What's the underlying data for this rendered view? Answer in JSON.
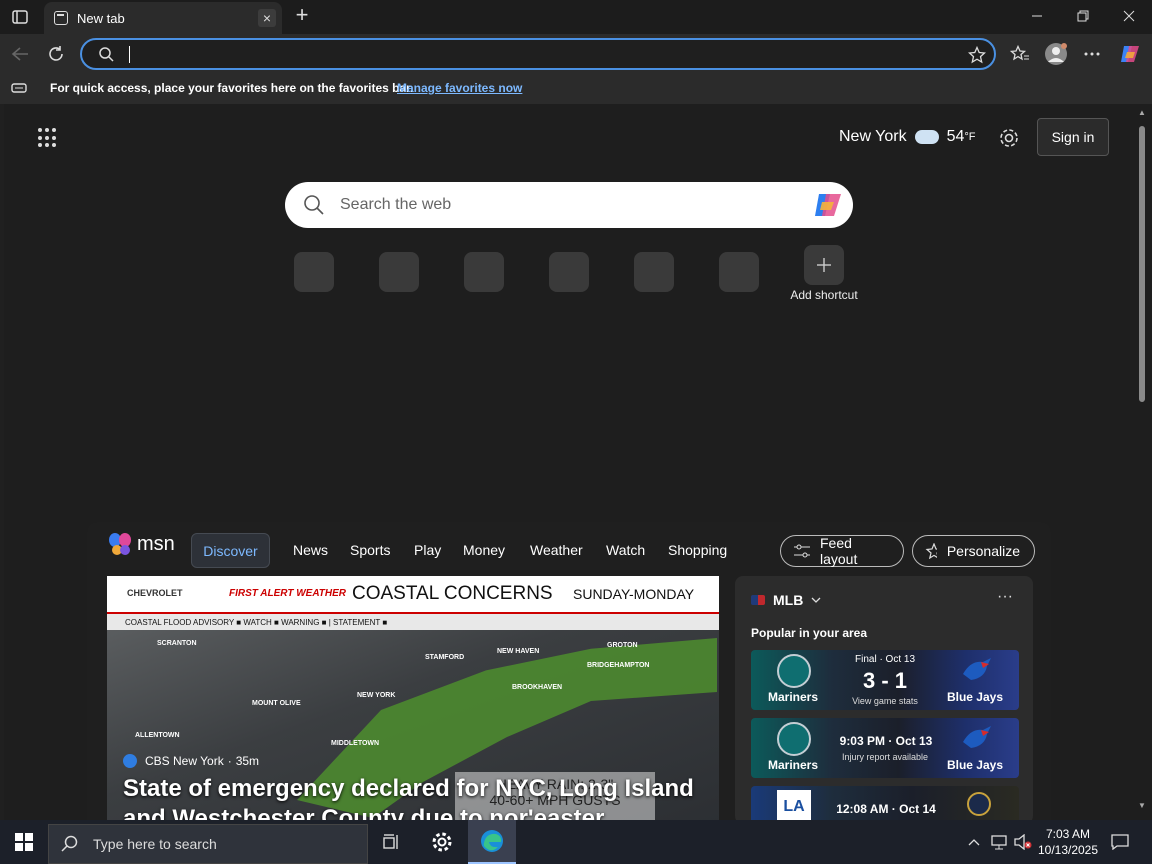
{
  "browser": {
    "tab_title": "New tab",
    "tab_close": "×",
    "new_tab": "+",
    "address_value": "",
    "favbar_message": "For quick access, place your favorites here on the favorites bar.",
    "favbar_link": "Manage favorites now"
  },
  "newtab": {
    "weather_city": "New York",
    "weather_temp": "54",
    "weather_unit": "°F",
    "sign_in": "Sign in",
    "search_placeholder": "Search the web",
    "add_shortcut_label": "Add shortcut"
  },
  "feed": {
    "logo_text": "msn",
    "active_tab": "Discover",
    "nav": [
      "News",
      "Sports",
      "Play",
      "Money",
      "Weather",
      "Watch",
      "Shopping"
    ],
    "feed_layout": "Feed layout",
    "personalize": "Personalize",
    "hero": {
      "banner_brand": "CHEVROLET",
      "banner_alert": "FIRST ALERT WEATHER",
      "banner_headline": "COASTAL CONCERNS",
      "banner_days": "SUNDAY-MONDAY",
      "legend": "COASTAL FLOOD ADVISORY ■  WATCH ■  WARNING ■   |   STATEMENT ■",
      "towns": [
        "SCRANTON",
        "STAMFORD",
        "NEW HAVEN",
        "GROTON",
        "BRIDGEHAMPTON",
        "BROOKHAVEN",
        "NEW YORK",
        "MOUNT OLIVE",
        "ALLENTOWN",
        "MIDDLETOWN"
      ],
      "rain_line1": "HEAVY RAIN: 2-3\"",
      "rain_line2": "40-60+ MPH GUSTS",
      "source": "CBS New York",
      "age": "35m",
      "story": "State of emergency declared for NYC, Long Island and Westchester County due to nor'easter"
    },
    "mlb": {
      "league": "MLB",
      "more": "···",
      "popular": "Popular in your area",
      "games": [
        {
          "team1": "Mariners",
          "team2": "Blue Jays",
          "status": "Final · Oct 13",
          "score": "3 - 1",
          "detail": "View game stats"
        },
        {
          "team1": "Mariners",
          "team2": "Blue Jays",
          "time": "9:03 PM · Oct 13",
          "detail": "Injury report available"
        },
        {
          "team1": "",
          "team2": "",
          "time": "12:08 AM · Oct 14",
          "detail": ""
        }
      ]
    }
  },
  "taskbar": {
    "search_placeholder": "Type here to search",
    "time": "7:03 AM",
    "date": "10/13/2025"
  }
}
